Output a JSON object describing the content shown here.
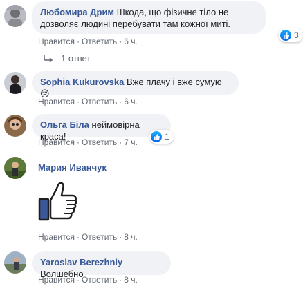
{
  "actions": {
    "like": "Нравится",
    "reply": "Ответить",
    "dot": "·"
  },
  "comments": [
    {
      "author": "Любомира Дрим",
      "text": "Шкода, що фізичне тіло не дозволяє людині перебувати там кожної миті.",
      "time": "6 ч.",
      "reactions": "3",
      "replies_label": "1 ответ"
    },
    {
      "author": "Sophia Kukurovska",
      "text": "Вже плачу і вже сумую😢",
      "time": "6 ч."
    },
    {
      "author": "Ольга Біла",
      "text": "неймовірна краса!",
      "time": "7 ч.",
      "reactions": "1"
    },
    {
      "author": "Мария Иванчук",
      "sticker": "thumbs-up-sticker",
      "time": "8 ч."
    },
    {
      "author": "Yaroslav Berezhniy",
      "text": "Волшебно",
      "time": "8 ч."
    }
  ],
  "colors": {
    "author": "#385898",
    "bubble": "#f0f2f5",
    "meta": "#606770",
    "like_blue": "#1877f2",
    "sticker_blue": "#3b5998"
  }
}
